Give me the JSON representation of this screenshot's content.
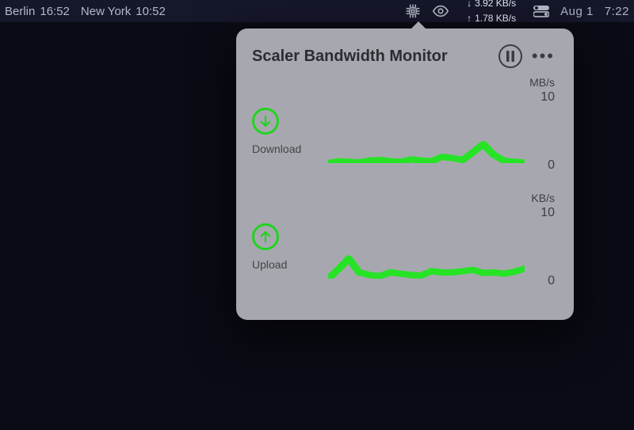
{
  "menubar": {
    "clocks": [
      {
        "city": "Berlin",
        "time": "16:52"
      },
      {
        "city": "New York",
        "time": "10:52"
      }
    ],
    "net": {
      "down": "3.92 KB/s",
      "up": "1.78 KB/s"
    },
    "date": "Aug 1",
    "time": "7:22"
  },
  "popover": {
    "title": "Scaler Bandwidth Monitor",
    "sections": {
      "download": {
        "label": "Download",
        "unit": "MB/s",
        "max": "10",
        "zero": "0"
      },
      "upload": {
        "label": "Upload",
        "unit": "KB/s",
        "max": "10",
        "zero": "0"
      }
    }
  },
  "chart_data": [
    {
      "type": "line",
      "title": "Download",
      "ylabel": "MB/s",
      "ylim": [
        0,
        10
      ],
      "x": [
        0,
        1,
        2,
        3,
        4,
        5,
        6,
        7,
        8,
        9,
        10,
        11,
        12,
        13,
        14,
        15,
        16,
        17,
        18,
        19
      ],
      "values": [
        0,
        0.3,
        0.2,
        0.1,
        0.4,
        0.5,
        0.3,
        0.2,
        0.6,
        0.4,
        0.3,
        1.0,
        0.8,
        0.5,
        1.7,
        3.0,
        1.3,
        0.4,
        0.2,
        0.1
      ]
    },
    {
      "type": "line",
      "title": "Upload",
      "ylabel": "KB/s",
      "ylim": [
        0,
        10
      ],
      "x": [
        0,
        1,
        2,
        3,
        4,
        5,
        6,
        7,
        8,
        9,
        10,
        11,
        12,
        13,
        14,
        15,
        16,
        17,
        18,
        19
      ],
      "values": [
        0,
        1.5,
        3.2,
        1.0,
        0.6,
        0.4,
        1.0,
        0.8,
        0.6,
        0.5,
        1.2,
        1.0,
        1.0,
        1.2,
        1.4,
        0.9,
        1.0,
        0.8,
        1.1,
        1.6
      ]
    }
  ]
}
